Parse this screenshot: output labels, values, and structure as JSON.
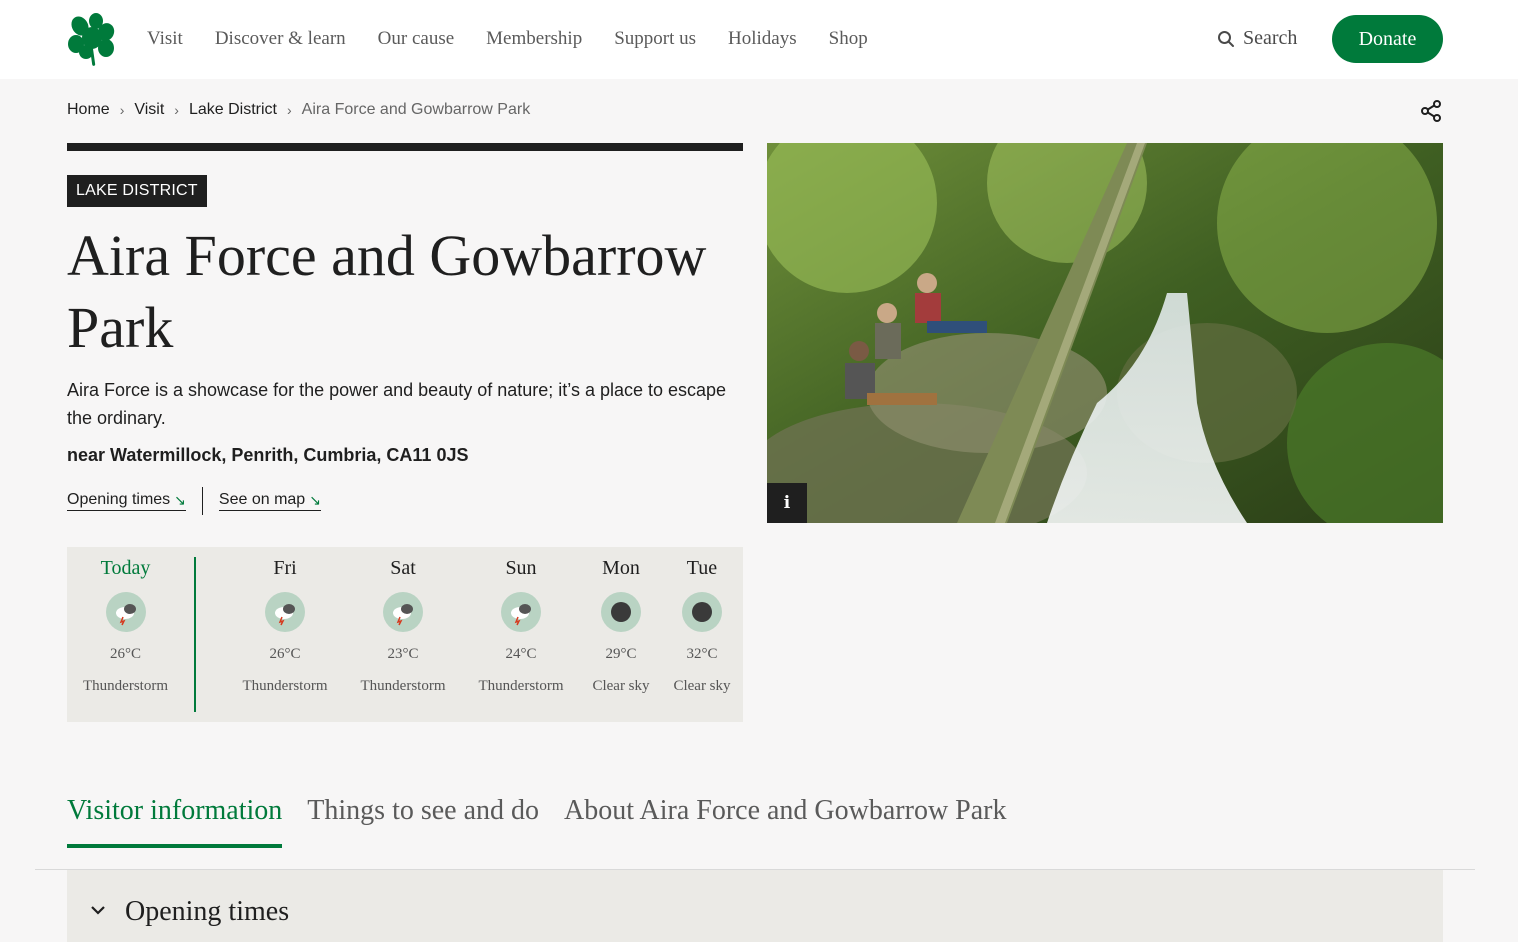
{
  "header": {
    "logo_icon": "oak-leaf-logo-icon",
    "nav": [
      "Visit",
      "Discover & learn",
      "Our cause",
      "Membership",
      "Support us",
      "Holidays",
      "Shop"
    ],
    "search_label": "Search",
    "donate_label": "Donate",
    "brand_color": "#007a3b"
  },
  "breadcrumb": [
    "Home",
    "Visit",
    "Lake District",
    "Aira Force and Gowbarrow Park"
  ],
  "place": {
    "region_tag": "LAKE DISTRICT",
    "title": "Aira Force and Gowbarrow Park",
    "description": "Aira Force is a showcase for the power and beauty of nature; it’s a place to escape the ordinary.",
    "address": "near Watermillock, Penrith, Cumbria, CA11 0JS",
    "links": [
      "Opening times",
      "See on map"
    ]
  },
  "weather": [
    {
      "day": "Today",
      "temp": "26°C",
      "condition": "Thunderstorm",
      "icon": "thunderstorm-icon"
    },
    {
      "day": "Fri",
      "temp": "26°C",
      "condition": "Thunderstorm",
      "icon": "thunderstorm-icon"
    },
    {
      "day": "Sat",
      "temp": "23°C",
      "condition": "Thunderstorm",
      "icon": "thunderstorm-icon"
    },
    {
      "day": "Sun",
      "temp": "24°C",
      "condition": "Thunderstorm",
      "icon": "thunderstorm-icon"
    },
    {
      "day": "Mon",
      "temp": "29°C",
      "condition": "Clear sky",
      "icon": "clear-sky-icon"
    },
    {
      "day": "Tue",
      "temp": "32°C",
      "condition": "Clear sky",
      "icon": "clear-sky-icon"
    }
  ],
  "hero": {
    "info_label": "i"
  },
  "tabs": [
    "Visitor information",
    "Things to see and do",
    "About Aira Force and Gowbarrow Park"
  ],
  "accordion": {
    "title": "Opening times"
  }
}
